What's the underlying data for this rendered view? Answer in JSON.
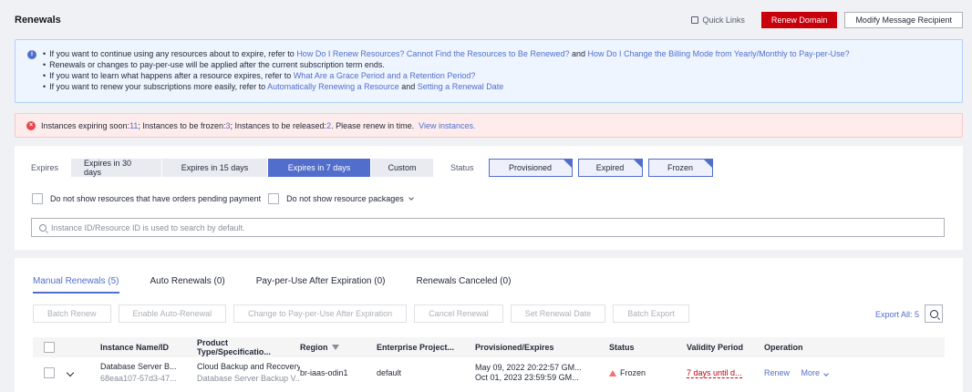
{
  "header": {
    "title": "Renewals",
    "quick_links": "Quick Links",
    "renew_domain": "Renew Domain",
    "modify_recipient": "Modify Message Recipient"
  },
  "info": {
    "line1_pre": "If you want to continue using any resources about to expire, refer to ",
    "line1_link1": "How Do I Renew Resources? Cannot Find the Resources to Be Renewed?",
    "line1_mid": " and ",
    "line1_link2": "How Do I Change the Billing Mode from Yearly/Monthly to Pay-per-Use?",
    "line2": "Renewals or changes to pay-per-use will be applied after the current subscription term ends.",
    "line3_pre": "If you want to learn what happens after a resource expires, refer to ",
    "line3_link": "What Are a Grace Period and a Retention Period?",
    "line4_pre": "If you want to renew your subscriptions more easily, refer to ",
    "line4_link1": "Automatically Renewing a Resource",
    "line4_mid": " and ",
    "line4_link2": "Setting a Renewal Date"
  },
  "alert": {
    "expiring_label": "Instances expiring soon: ",
    "expiring_count": "11",
    "frozen_label": " ; Instances to be frozen: ",
    "frozen_count": "3",
    "released_label": " ; Instances to be released: ",
    "released_count": "2",
    "suffix": " . Please renew in time.",
    "view_link": "View instances."
  },
  "filters": {
    "expires_label": "Expires",
    "expires_options": [
      "Expires in 30 days",
      "Expires in 15 days",
      "Expires in 7 days",
      "Custom"
    ],
    "status_label": "Status",
    "status_tags": [
      "Provisioned",
      "Expired",
      "Frozen"
    ],
    "check_pending": "Do not show resources that have orders pending payment",
    "check_packages": "Do not show resource packages",
    "search_placeholder": "Instance ID/Resource ID is used to search by default."
  },
  "tabs": [
    "Manual Renewals (5)",
    "Auto Renewals (0)",
    "Pay-per-Use After Expiration (0)",
    "Renewals Canceled (0)"
  ],
  "actions": {
    "batch_renew": "Batch Renew",
    "enable_auto": "Enable Auto-Renewal",
    "change_ppu": "Change to Pay-per-Use After Expiration",
    "cancel_renewal": "Cancel Renewal",
    "set_date": "Set Renewal Date",
    "batch_export": "Batch Export",
    "export_all": "Export All: 5"
  },
  "table": {
    "columns": [
      "Instance Name/ID",
      "Product Type/Specificatio...",
      "Region",
      "Enterprise Project...",
      "Provisioned/Expires",
      "Status",
      "Validity Period",
      "Operation"
    ],
    "rows": [
      {
        "name": "Database Server B...",
        "id": "68eaa107-57d3-47...",
        "product": "Cloud Backup and Recovery",
        "spec": "Database Server Backup V...",
        "region": "br-iaas-odin1",
        "project": "default",
        "provisioned": "May 09, 2022 20:22:57 GM...",
        "expires": "Oct 01, 2023 23:59:59 GM...",
        "status": "Frozen",
        "validity": "7 days until d...",
        "op_renew": "Renew",
        "op_more": "More"
      }
    ]
  },
  "colors": {
    "brand_red": "#c7000b",
    "link_blue": "#526ecc",
    "info_bg": "#eef5ff",
    "alert_bg": "#fdeceb"
  }
}
